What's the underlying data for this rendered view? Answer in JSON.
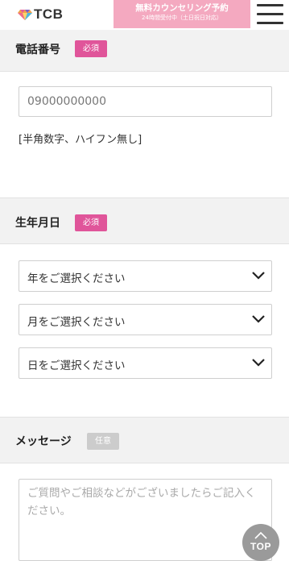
{
  "header": {
    "logo_text": "TCB",
    "banner_main": "無料カウンセリング予約",
    "banner_sub": "24時間受付中（土日祝日対応）"
  },
  "phone": {
    "title": "電話番号",
    "badge": "必須",
    "value": "09000000000",
    "note": "[半角数字、ハイフン無し]"
  },
  "birthdate": {
    "title": "生年月日",
    "badge": "必須",
    "year_placeholder": "年をご選択ください",
    "month_placeholder": "月をご選択ください",
    "day_placeholder": "日をご選択ください"
  },
  "message": {
    "title": "メッセージ",
    "badge": "任意",
    "placeholder": "ご質問やご相談などがございましたらご記入ください。"
  },
  "top_button": {
    "label": "TOP"
  },
  "colors": {
    "required_badge": "#e0559a",
    "optional_badge": "#cccccc",
    "banner": "#f4a9c0",
    "section_bar": "#f2f2f2"
  },
  "icons": [
    "tcb-gem-logo-icon",
    "hamburger-menu-icon",
    "chevron-down-icon",
    "arrow-up-icon"
  ]
}
